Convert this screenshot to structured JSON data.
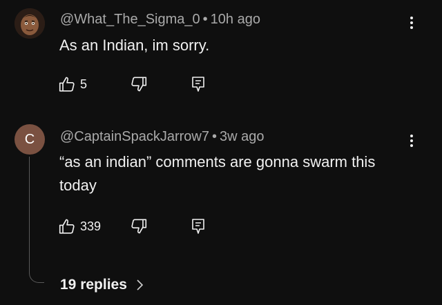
{
  "comments": [
    {
      "author": "@What_The_Sigma_0",
      "time": "10h ago",
      "text": "As an Indian, im sorry.",
      "likes": "5"
    },
    {
      "author": "@CaptainSpackJarrow7",
      "time": "3w ago",
      "text": "“as an indian” comments are gonna swarm this today",
      "likes": "339",
      "avatar_letter": "C",
      "replies_label": "19 replies"
    }
  ],
  "separator": "•",
  "icons": {
    "like": "thumbs-up-icon",
    "dislike": "thumbs-down-icon",
    "reply": "reply-comment-icon",
    "menu": "more-vertical-icon",
    "replies_arrow": "chevron-right-icon"
  },
  "colors": {
    "background": "#0f0f0f",
    "text": "#f1f1f1",
    "meta": "#aaaaaa",
    "avatar_c": "#7a5141"
  }
}
